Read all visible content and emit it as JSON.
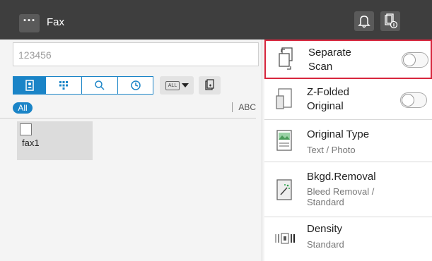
{
  "header": {
    "title": "Fax",
    "menu_glyph": "···"
  },
  "destination": {
    "value": "123456"
  },
  "index": {
    "all_label": "All",
    "abc_label": "ABC",
    "all_select_text": "ALL"
  },
  "addresses": [
    {
      "name": "fax1"
    }
  ],
  "settings": [
    {
      "label": "Separate Scan",
      "label_lines": [
        "Separate",
        "Scan"
      ],
      "toggle": "off"
    },
    {
      "label": "Z-Folded Original",
      "label_lines": [
        "Z-Folded",
        "Original"
      ],
      "toggle": "off"
    },
    {
      "label": "Original Type",
      "value": "Text / Photo"
    },
    {
      "label": "Bkgd.Removal",
      "value_lines": [
        "Bleed Removal /",
        "Standard"
      ]
    },
    {
      "label": "Density",
      "value": "Standard"
    }
  ],
  "colors": {
    "accent": "#1a84c7",
    "selected_border": "#d7263d",
    "header_bg": "#3e3e3e"
  }
}
